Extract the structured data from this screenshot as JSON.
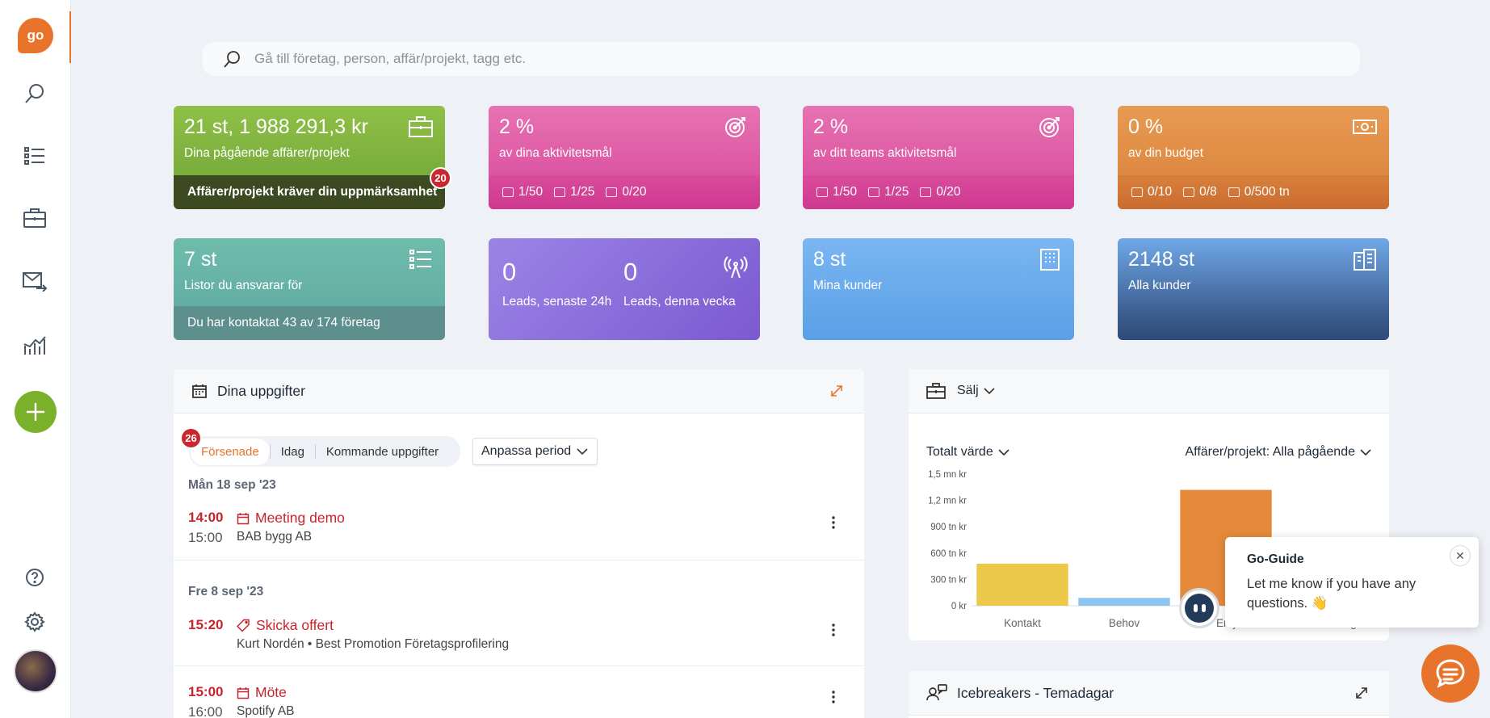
{
  "sidebar": {
    "logo_text": "go",
    "items": [
      {
        "icon": "search-icon"
      },
      {
        "icon": "list-icon"
      },
      {
        "icon": "briefcase-icon"
      },
      {
        "icon": "mail-forward-icon"
      },
      {
        "icon": "chart-icon"
      }
    ],
    "bottom": [
      {
        "icon": "help-icon"
      },
      {
        "icon": "gear-icon"
      }
    ]
  },
  "search": {
    "placeholder": "Gå till företag, person, affär/projekt, tagg etc."
  },
  "cards": {
    "deals": {
      "big": "21 st, 1 988 291,3 kr",
      "sub": "Dina pågående affärer/projekt",
      "footer": "Affärer/projekt kräver din uppmärksamhet",
      "badge": "20"
    },
    "my_activity": {
      "big": "2 %",
      "sub": "av dina aktivitetsmål",
      "f1": "1/50",
      "f2": "1/25",
      "f3": "0/20"
    },
    "team_activity": {
      "big": "2 %",
      "sub": "av ditt teams aktivitetsmål",
      "f1": "1/50",
      "f2": "1/25",
      "f3": "0/20"
    },
    "budget": {
      "big": "0 %",
      "sub": "av din budget",
      "f1": "0/10",
      "f2": "0/8",
      "f3": "0/500 tn"
    },
    "lists": {
      "big": "7 st",
      "sub": "Listor du ansvarar för",
      "footer": "Du har kontaktat 43 av 174 företag"
    },
    "leads": {
      "v1": "0",
      "l1": "Leads, senaste 24h",
      "v2": "0",
      "l2": "Leads, denna vecka"
    },
    "my_customers": {
      "big": "8 st",
      "sub": "Mina kunder"
    },
    "all_customers": {
      "big": "2148 st",
      "sub": "Alla kunder"
    }
  },
  "tasks": {
    "title": "Dina uppgifter",
    "badge": "26",
    "tabs": [
      "Försenade",
      "Idag",
      "Kommande uppgifter"
    ],
    "period_button": "Anpassa period",
    "groups": [
      {
        "date": "Mån 18 sep '23",
        "items": [
          {
            "start": "14:00",
            "end": "15:00",
            "title": "Meeting demo",
            "sub": "BAB bygg AB",
            "icon": "calendar-icon"
          }
        ]
      },
      {
        "date": "Fre 8 sep '23",
        "items": [
          {
            "start": "15:20",
            "end": "",
            "title": "Skicka offert",
            "sub": "Kurt Nordén  •  Best Promotion Företagsprofilering",
            "icon": "tag-icon"
          }
        ]
      },
      {
        "date": "",
        "items": [
          {
            "start": "15:00",
            "end": "16:00",
            "title": "Möte",
            "sub": "Spotify AB",
            "icon": "calendar-icon"
          }
        ]
      }
    ]
  },
  "sales": {
    "title": "Sälj",
    "metric_dropdown": "Totalt värde",
    "filter_dropdown": "Affärer/projekt: Alla pågående"
  },
  "chart_data": {
    "type": "bar",
    "categories": [
      "Kontakt",
      "Behov",
      "Erbj",
      "Förhandling"
    ],
    "category_labels_visible": [
      "Kontakt",
      "Behov",
      "Erbj",
      "Förhandling"
    ],
    "values": [
      480000,
      90000,
      1320000,
      0
    ],
    "colors": [
      "#ecc94b",
      "#8cc4f2",
      "#e58a3a",
      "#cccccc"
    ],
    "ylim": [
      0,
      1500000
    ],
    "yticks": [
      0,
      300000,
      600000,
      900000,
      1200000,
      1500000
    ],
    "ytick_labels": [
      "0 kr",
      "300 tn kr",
      "600 tn kr",
      "900 tn kr",
      "1,2 mn kr",
      "1,5 mn kr"
    ],
    "title": "",
    "xlabel": "",
    "ylabel": ""
  },
  "icebreakers": {
    "title": "Icebreakers - Temadagar"
  },
  "guide": {
    "title": "Go-Guide",
    "body": "Let me know if you have any questions. 👋"
  }
}
